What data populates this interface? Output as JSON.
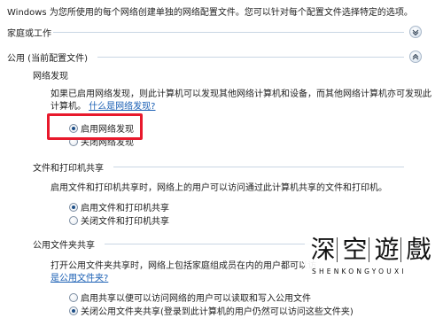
{
  "intro_text": "Windows 为您所使用的每个网络创建单独的网络配置文件。您可以针对每个配置文件选择特定的选项。",
  "profiles": {
    "home_work": {
      "title": "家庭或工作",
      "expanded": false
    },
    "public": {
      "title": "公用 (当前配置文件)",
      "expanded": true
    }
  },
  "network_discovery": {
    "title": "网络发现",
    "description_line1": "如果已启用网络发现，则此计算机可以发现其他网络计算机和设备，而其他网络计算机亦可发现此",
    "description_line2": "计算机。",
    "link": "什么是网络发现?",
    "options": [
      {
        "label": "启用网络发现",
        "checked": true
      },
      {
        "label": "关闭网络发现",
        "checked": false
      }
    ]
  },
  "file_printer_sharing": {
    "title": "文件和打印机共享",
    "description": "启用文件和打印机共享时，网络上的用户可以访问通过此计算机共享的文件和打印机。",
    "options": [
      {
        "label": "启用文件和打印机共享",
        "checked": true
      },
      {
        "label": "关闭文件和打印机共享",
        "checked": false
      }
    ]
  },
  "public_folder_sharing": {
    "title": "公用文件夹共享",
    "description_line1": "打开公用文件夹共享时，网络上包括家庭组成员在内的用户都可以访",
    "link": "是公用文件夹?",
    "options": [
      {
        "label": "启用共享以便可以访问网络的用户可以读取和写入公用文件",
        "checked": false
      },
      {
        "label": "关闭公用文件夹共享(登录到此计算机的用户仍然可以访问这些文件夹)",
        "checked": true
      }
    ]
  },
  "watermark": {
    "chars": [
      "深",
      "空",
      "遊",
      "戲"
    ],
    "subtitle": "SHENKONGYOUXI"
  },
  "colors": {
    "highlight": "#e8192c",
    "link": "#1a5fb4",
    "divider": "#c9d6e4"
  }
}
